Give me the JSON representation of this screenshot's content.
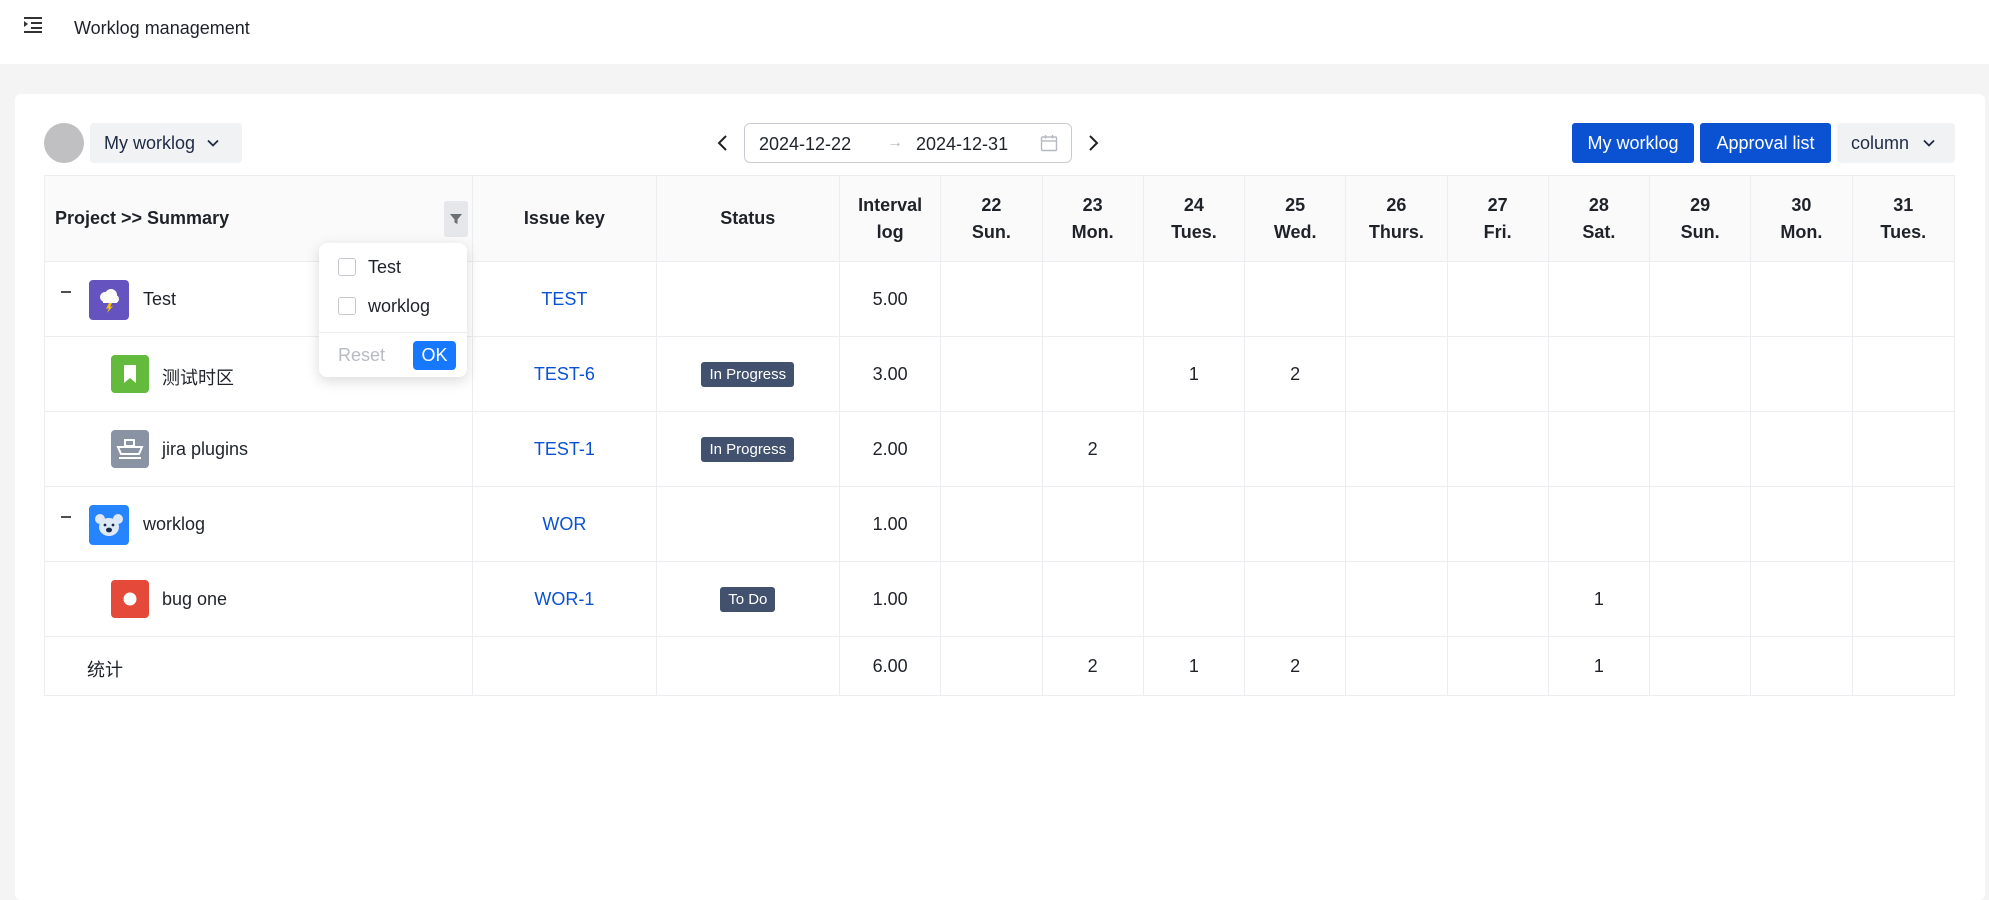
{
  "header": {
    "title": "Worklog management",
    "menu_icon": "menu-fold-icon"
  },
  "toolbar": {
    "user_select": "My worklog",
    "date_start": "2024-12-22",
    "date_end": "2024-12-31",
    "range_separator": "→",
    "my_worklog_button": "My worklog",
    "approval_button": "Approval list",
    "column_select": "column",
    "accent_color": "#0b52d3"
  },
  "table": {
    "headers": {
      "project": "Project  >> Summary",
      "issue_key": "Issue key",
      "status": "Status",
      "interval_line1": "Interval",
      "interval_line2": "log"
    },
    "days": [
      {
        "num": "22",
        "dow": "Sun."
      },
      {
        "num": "23",
        "dow": "Mon."
      },
      {
        "num": "24",
        "dow": "Tues."
      },
      {
        "num": "25",
        "dow": "Wed."
      },
      {
        "num": "26",
        "dow": "Thurs."
      },
      {
        "num": "27",
        "dow": "Fri."
      },
      {
        "num": "28",
        "dow": "Sat."
      },
      {
        "num": "29",
        "dow": "Sun."
      },
      {
        "num": "30",
        "dow": "Mon."
      },
      {
        "num": "31",
        "dow": "Tues."
      }
    ],
    "rows": [
      {
        "type": "project",
        "name": "Test",
        "key": "TEST",
        "status": "",
        "interval": "5.00",
        "days": [
          "",
          "",
          "",
          "",
          "",
          "",
          "",
          "",
          "",
          ""
        ],
        "icon": "storm-project-icon",
        "icon_color": "#6554c0"
      },
      {
        "type": "issue",
        "name": "测试时区",
        "key": "TEST-6",
        "status": "In Progress",
        "interval": "3.00",
        "days": [
          "",
          "",
          "1",
          "2",
          "",
          "",
          "",
          "",
          "",
          ""
        ],
        "icon": "bookmark-story-icon",
        "icon_color": "#63ba3c"
      },
      {
        "type": "issue",
        "name": "jira plugins",
        "key": "TEST-1",
        "status": "In Progress",
        "interval": "2.00",
        "days": [
          "",
          "2",
          "",
          "",
          "",
          "",
          "",
          "",
          "",
          ""
        ],
        "icon": "ship-icon",
        "icon_color": "#8993a4"
      },
      {
        "type": "project",
        "name": "worklog",
        "key": "WOR",
        "status": "",
        "interval": "1.00",
        "days": [
          "",
          "",
          "",
          "",
          "",
          "",
          "",
          "",
          "",
          ""
        ],
        "icon": "koala-project-icon",
        "icon_color": "#2684ff"
      },
      {
        "type": "issue",
        "name": "bug one",
        "key": "WOR-1",
        "status": "To Do",
        "interval": "1.00",
        "days": [
          "",
          "",
          "",
          "",
          "",
          "",
          "1",
          "",
          "",
          ""
        ],
        "icon": "bug-icon",
        "icon_color": "#e5493a"
      }
    ],
    "total": {
      "label": "统计",
      "interval": "6.00",
      "days": [
        "",
        "2",
        "1",
        "2",
        "",
        "",
        "1",
        "",
        "",
        ""
      ]
    }
  },
  "filter_popup": {
    "options": [
      "Test",
      "worklog"
    ],
    "reset_label": "Reset",
    "ok_label": "OK"
  }
}
